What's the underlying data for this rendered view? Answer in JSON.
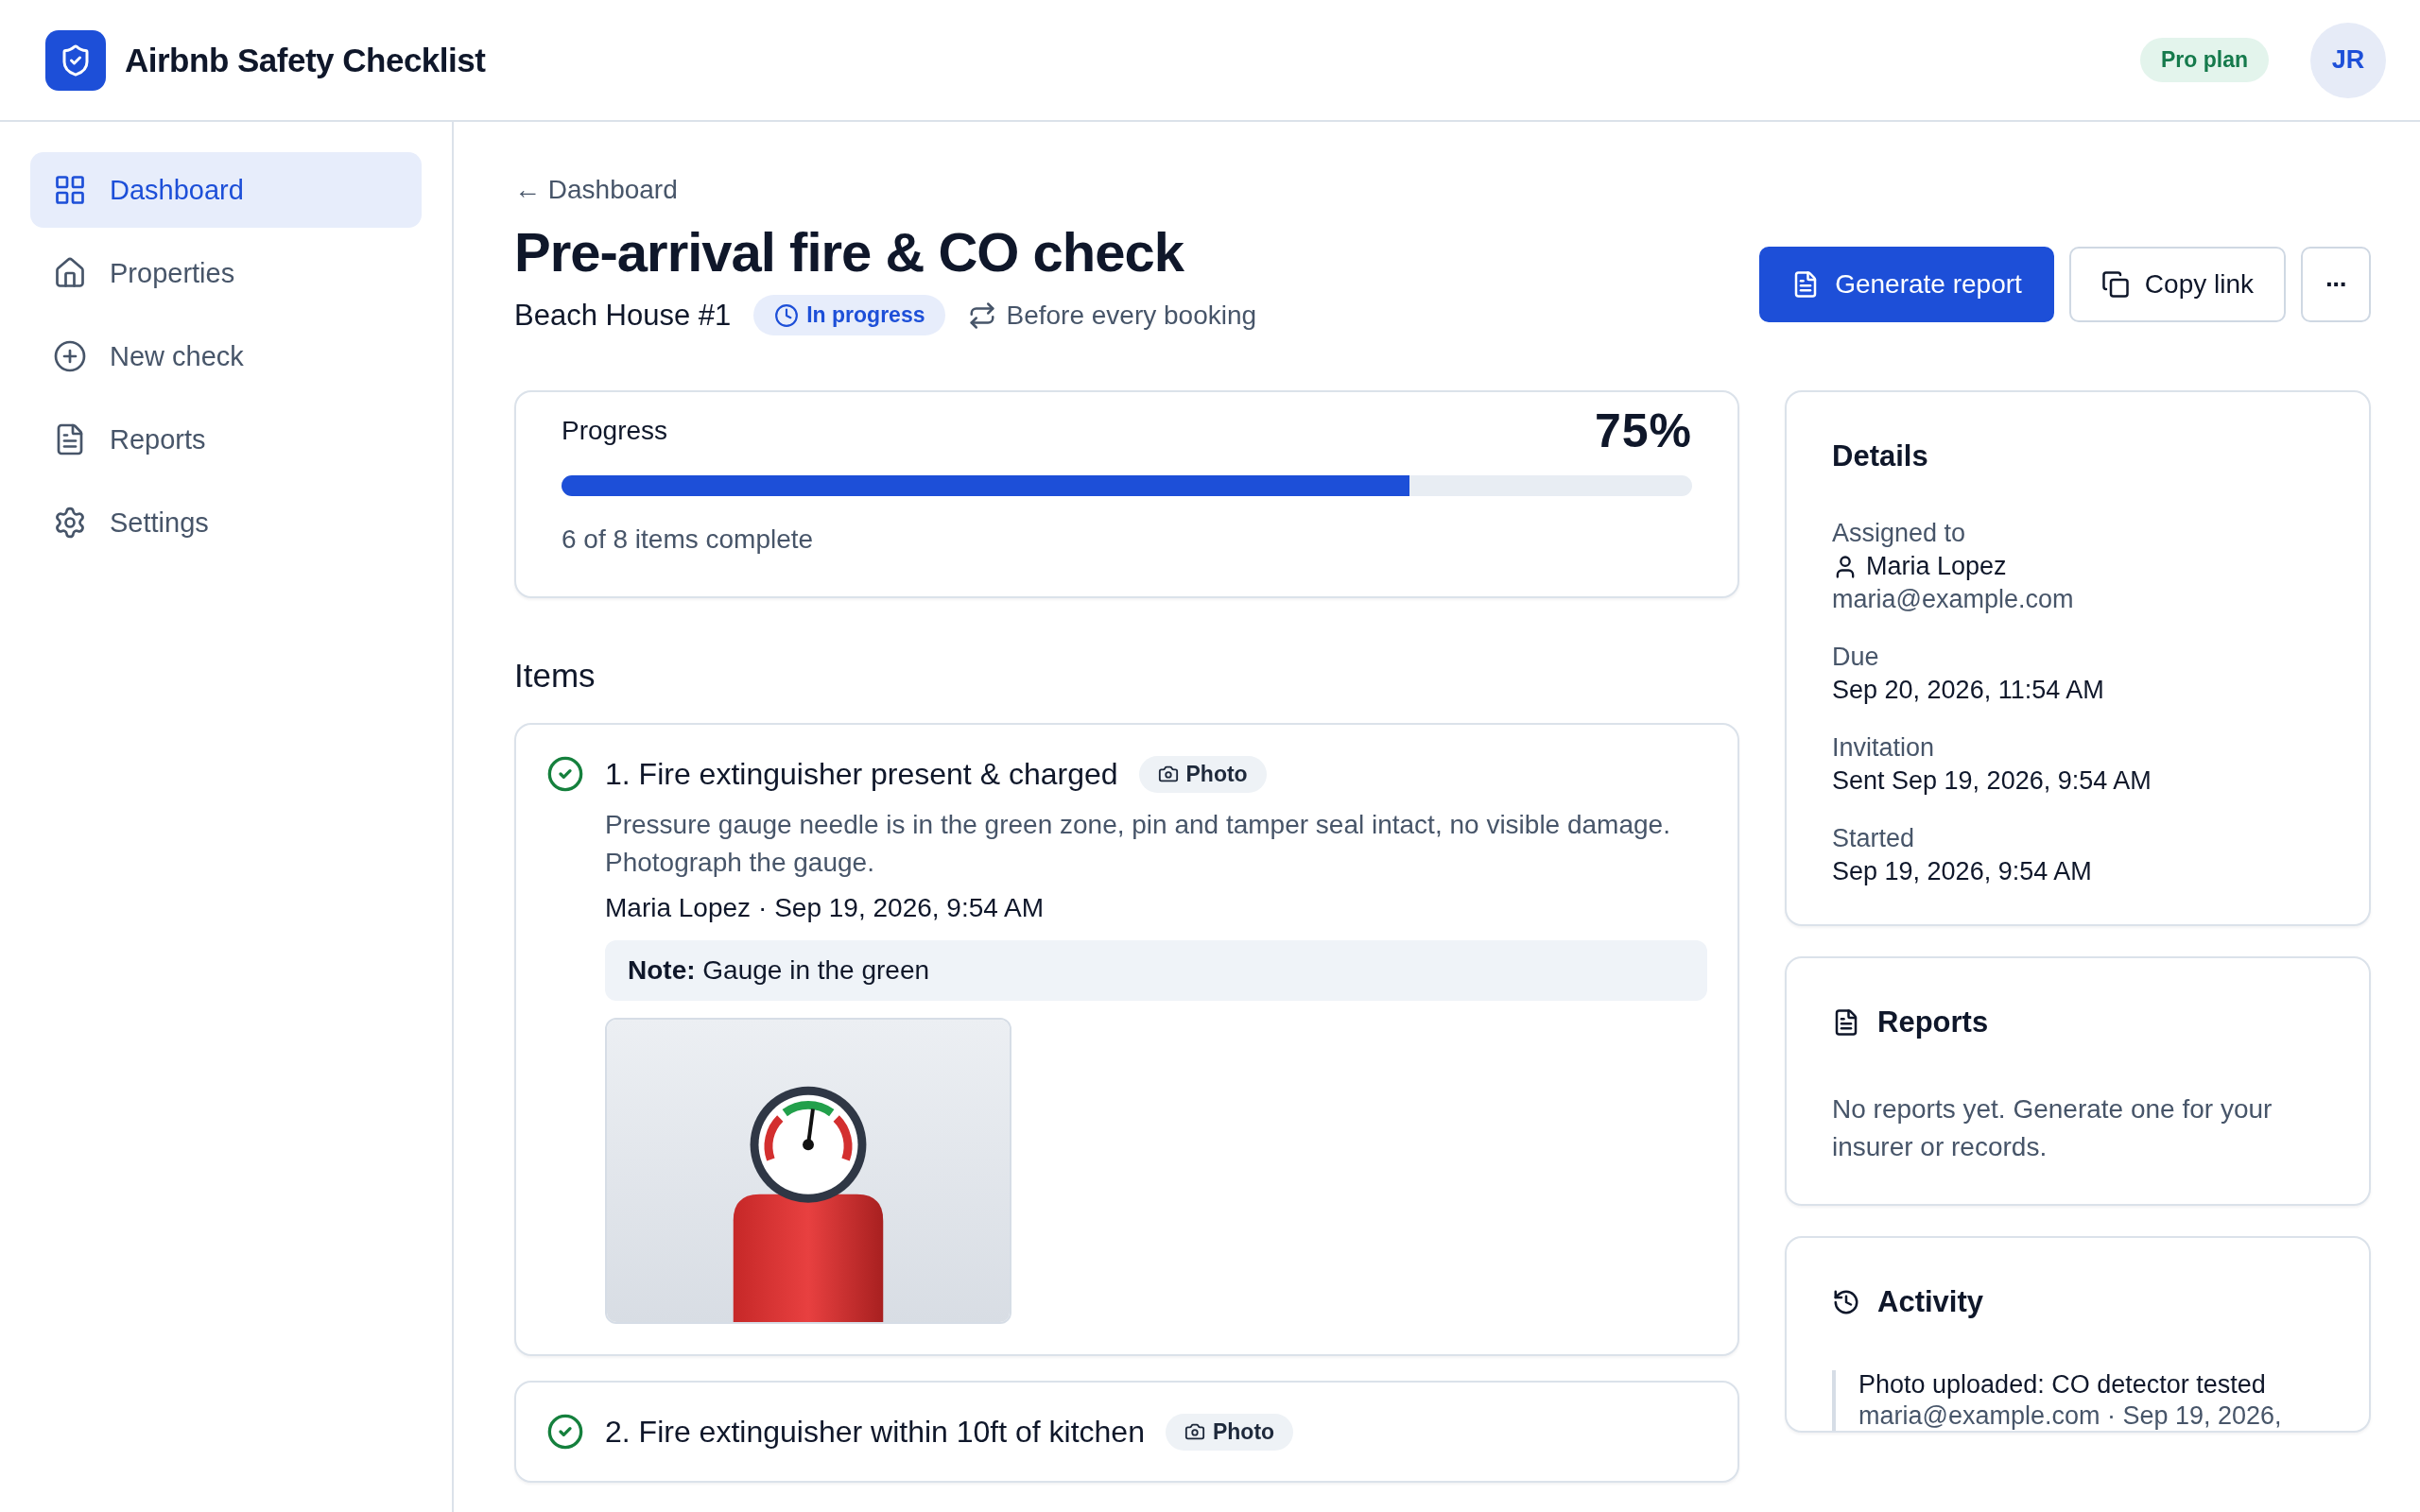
{
  "app": {
    "title": "Airbnb Safety Checklist",
    "plan": "Pro plan",
    "avatar": "JR"
  },
  "sidebar": {
    "items": [
      {
        "label": "Dashboard",
        "selected": true
      },
      {
        "label": "Properties",
        "selected": false
      },
      {
        "label": "New check",
        "selected": false
      },
      {
        "label": "Reports",
        "selected": false
      },
      {
        "label": "Settings",
        "selected": false
      }
    ]
  },
  "back_link": "← Dashboard",
  "page": {
    "title": "Pre-arrival fire & CO check",
    "property": "Beach House #1",
    "status": "In progress",
    "schedule": "Before every booking"
  },
  "actions": {
    "generate": "Generate report",
    "copy": "Copy link",
    "more": "···"
  },
  "progress": {
    "label": "Progress",
    "percent": "75%",
    "level": 0.75,
    "summary": "6 of 8 items complete"
  },
  "items_heading": "Items",
  "items": [
    {
      "title": "1. Fire extinguisher present & charged",
      "done": true,
      "tag": "Photo",
      "description": "Pressure gauge needle is in the green zone, pin and tamper seal intact, no visible damage. Photograph the gauge.",
      "author": "Maria Lopez",
      "time": "· Sep 19, 2026, 9:54 AM",
      "note_label": "Note:",
      "note": "Gauge in the green"
    },
    {
      "title": "2. Fire extinguisher within 10ft of kitchen",
      "done": true,
      "tag": "Photo"
    }
  ],
  "details": {
    "heading": "Details",
    "fields": [
      {
        "label": "Assigned to",
        "value": "Maria Lopez",
        "sub": "maria@example.com",
        "kind": "person"
      },
      {
        "label": "Due",
        "value": "Sep 20, 2026, 11:54 AM",
        "kind": "text"
      },
      {
        "label": "Invitation",
        "value": "Sent Sep 19, 2026, 9:54 AM",
        "kind": "text"
      },
      {
        "label": "Started",
        "value": "Sep 19, 2026, 9:54 AM",
        "kind": "text"
      }
    ]
  },
  "reports": {
    "heading": "Reports",
    "empty": "No reports yet. Generate one for your insurer or records."
  },
  "activity": {
    "heading": "Activity",
    "entries": [
      {
        "title": "Photo uploaded: CO detector tested",
        "meta": "maria@example.com · Sep 19, 2026,"
      }
    ]
  }
}
